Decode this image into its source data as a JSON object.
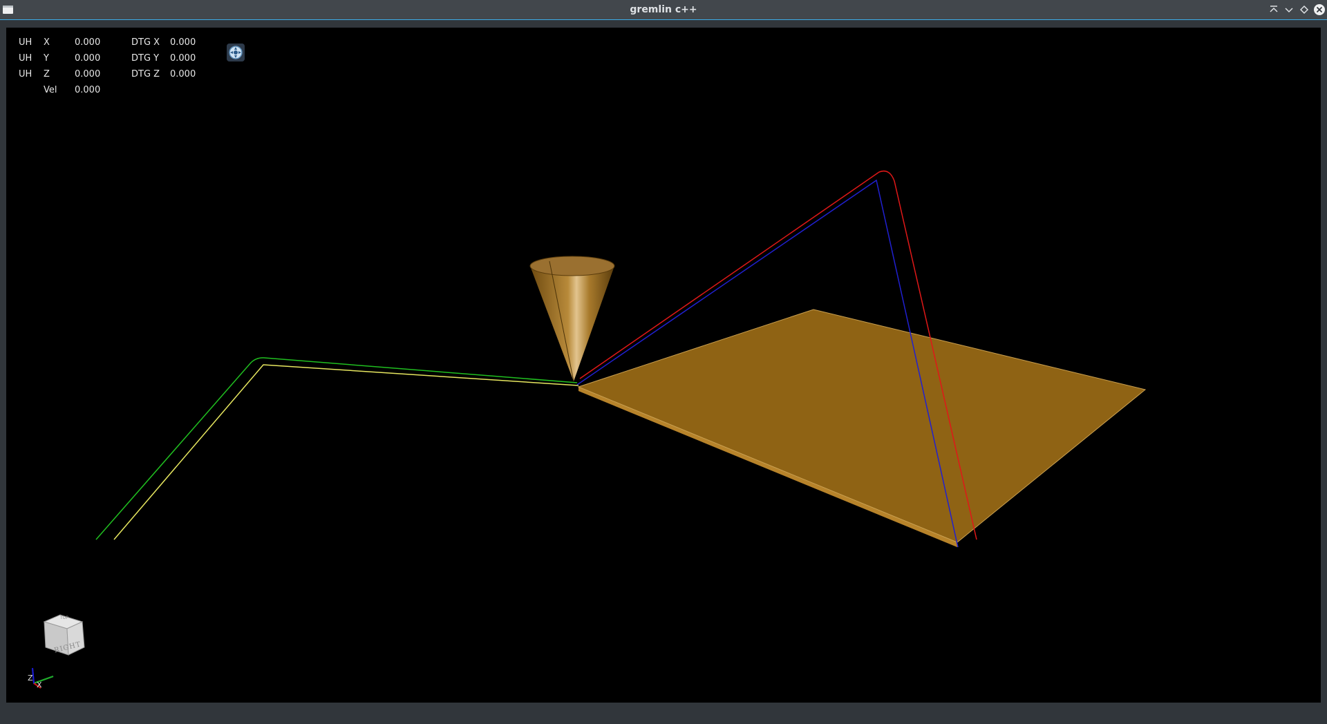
{
  "window": {
    "title": "gremlin c++",
    "buttons": [
      "keep-above-icon",
      "minimize-icon",
      "maximize-icon",
      "close-icon"
    ]
  },
  "dro": {
    "rows": [
      {
        "prefix": "UH",
        "axis": "X",
        "value": "0.000",
        "dtg_label": "DTG X",
        "dtg_value": "0.000"
      },
      {
        "prefix": "UH",
        "axis": "Y",
        "value": "0.000",
        "dtg_label": "DTG Y",
        "dtg_value": "0.000"
      },
      {
        "prefix": "UH",
        "axis": "Z",
        "value": "0.000",
        "dtg_label": "DTG Z",
        "dtg_value": "0.000"
      }
    ],
    "vel_label": "Vel",
    "vel_value": "0.000"
  },
  "view_cube": {
    "face_label": "RIGHT",
    "axis_z": "Z",
    "axis_x": "X"
  },
  "colors": {
    "background": "#000000",
    "tool": "#9a6a1a",
    "plate": "#8f6314",
    "rapid_path": "#e01818",
    "feed_path": "#2020d0",
    "path_green": "#20c020",
    "path_yellow": "#e8e860"
  }
}
